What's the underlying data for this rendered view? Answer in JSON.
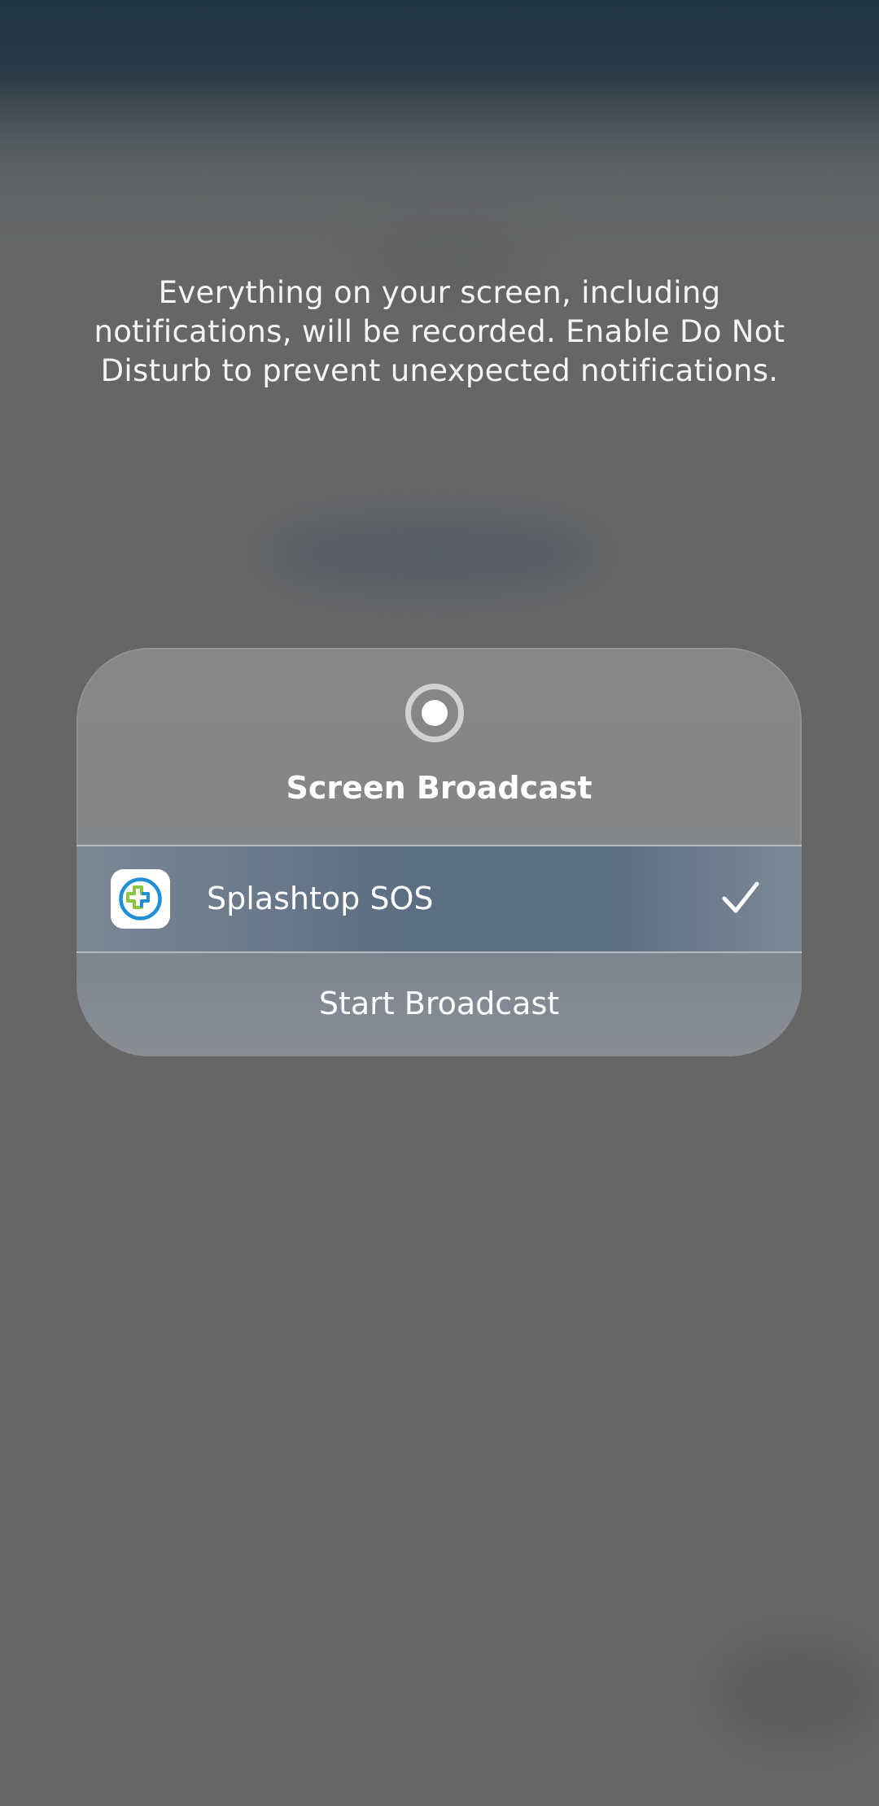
{
  "message": {
    "line1": "Everything on your screen, including",
    "line2": "notifications, will be recorded. Enable Do Not",
    "line3": "Disturb to prevent unexpected notifications."
  },
  "sheet": {
    "header_icon": "record-icon",
    "title": "Screen Broadcast",
    "app": {
      "icon": "splashtop-app-icon",
      "name": "Splashtop SOS",
      "selected": true,
      "check_icon": "checkmark-icon"
    },
    "start_label": "Start Broadcast"
  },
  "colors": {
    "background": "#666666",
    "top_tint": "#223644",
    "sheet": "#878787",
    "selected_row": "#5e7085",
    "icon_blue": "#1f8fd6",
    "icon_green": "#8cc63f",
    "text": "#ffffff"
  }
}
